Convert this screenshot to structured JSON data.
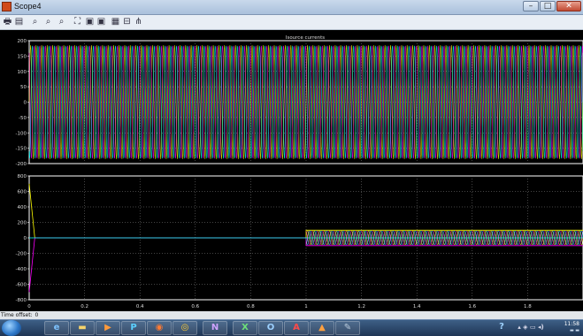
{
  "window": {
    "title": "Scope4"
  },
  "toolbar": {
    "icons": [
      "print-icon",
      "parameters-icon",
      "zoom-icon",
      "zoom-x-icon",
      "zoom-y-icon",
      "autoscale-icon",
      "save-axes-icon",
      "restore-axes-icon",
      "floating-scope-icon",
      "lock-axes-icon",
      "signal-selector-icon"
    ]
  },
  "plot_top": {
    "title": "Isource currents",
    "ytick_labels": [
      "200",
      "150",
      "100",
      "50",
      "0",
      "-50",
      "-100",
      "-150",
      "-200"
    ]
  },
  "plot_bottom": {
    "ytick_labels": [
      "800",
      "600",
      "400",
      "200",
      "0",
      "-200",
      "-400",
      "-600",
      "-800"
    ],
    "xtick_labels": [
      "0",
      "0.2",
      "0.4",
      "0.6",
      "0.8",
      "1",
      "1.2",
      "1.4",
      "1.6",
      "1.8"
    ]
  },
  "status": {
    "time_offset_label": "Time offset:",
    "time_offset_value": "0"
  },
  "taskbar": {
    "items": [
      "ie-icon",
      "explorer-icon",
      "media-player-icon",
      "publisher-icon",
      "firefox-icon",
      "chrome-icon",
      "onenote-icon",
      "excel-icon",
      "outlook-icon",
      "acrobat-icon",
      "matlab-icon",
      "paint-icon"
    ],
    "clock_time": "11:58"
  },
  "chart_data": [
    {
      "type": "line",
      "title": "Isource currents",
      "xlim": [
        0,
        2
      ],
      "ylim": [
        -200,
        200
      ],
      "grid": true,
      "series": [
        {
          "color": "#ffff00",
          "amplitude": 185,
          "phase_deg": 0
        },
        {
          "color": "#ff00ff",
          "amplitude": 185,
          "phase_deg": 120
        },
        {
          "color": "#00ffff",
          "amplitude": 185,
          "phase_deg": 240
        }
      ]
    },
    {
      "type": "line",
      "xlim": [
        0,
        2
      ],
      "ylim": [
        -800,
        800
      ],
      "grid": true,
      "series": [
        {
          "color": "#ffff00",
          "x": [
            0,
            0.02,
            0.05,
            1.0,
            1.0,
            2.0
          ],
          "y": [
            700,
            0,
            0,
            0,
            100,
            100
          ]
        },
        {
          "color": "#ff00ff",
          "x": [
            0,
            0.02,
            0.05,
            1.0,
            1.0,
            2.0
          ],
          "y": [
            -700,
            0,
            0,
            0,
            -100,
            -100
          ]
        },
        {
          "color": "#00ffff",
          "x": [
            0,
            2.0
          ],
          "y": [
            0,
            0
          ]
        }
      ]
    }
  ]
}
